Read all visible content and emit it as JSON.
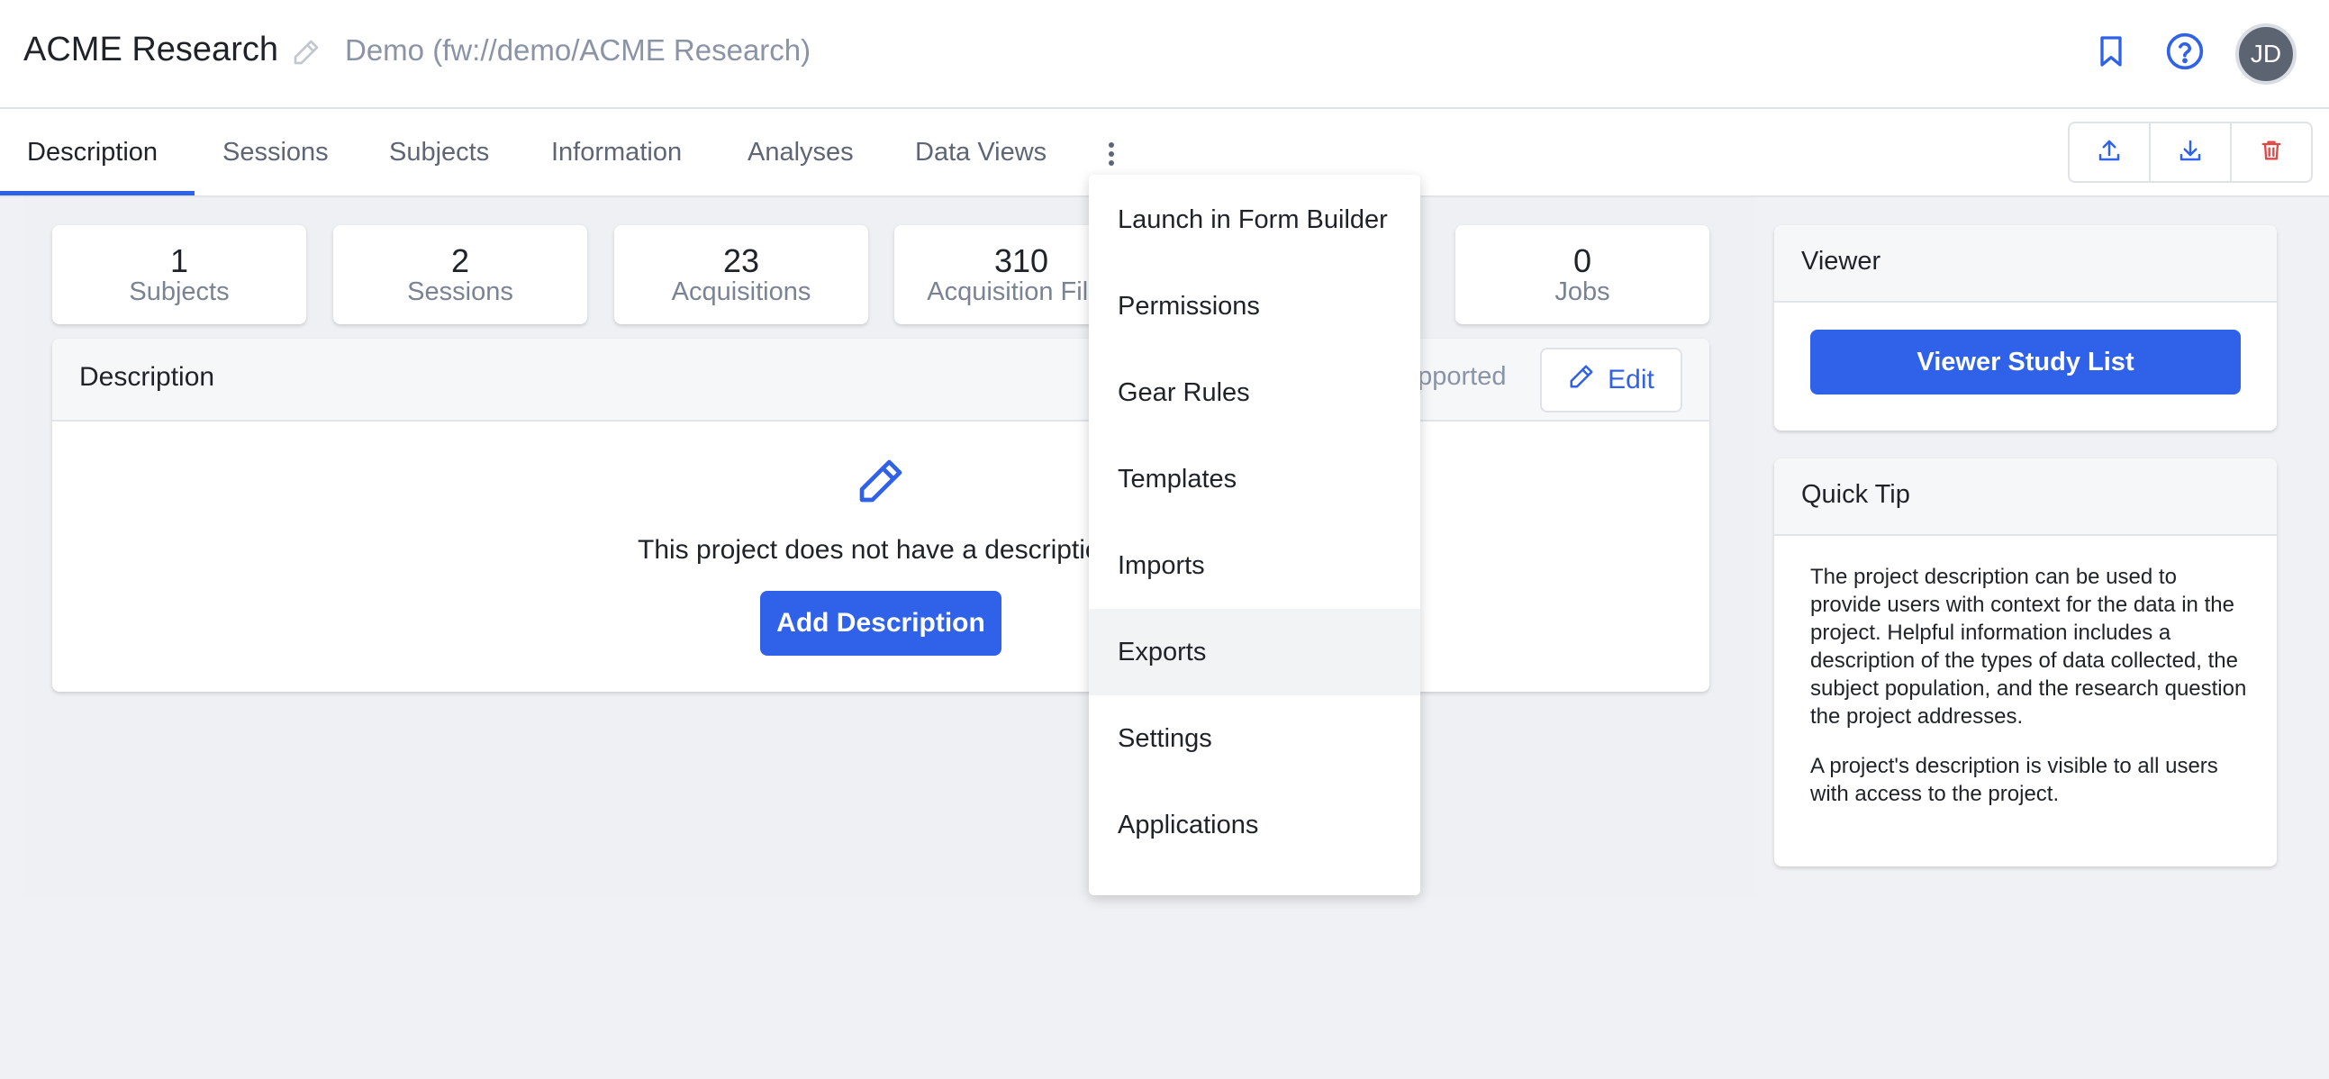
{
  "header": {
    "project_title": "ACME Research",
    "project_path": "Demo (fw://demo/ACME Research)",
    "avatar_initials": "JD"
  },
  "tabs": [
    {
      "label": "Description",
      "active": true
    },
    {
      "label": "Sessions"
    },
    {
      "label": "Subjects"
    },
    {
      "label": "Information"
    },
    {
      "label": "Analyses"
    },
    {
      "label": "Data Views"
    }
  ],
  "stats": [
    {
      "value": "1",
      "label": "Subjects"
    },
    {
      "value": "2",
      "label": "Sessions"
    },
    {
      "value": "23",
      "label": "Acquisitions"
    },
    {
      "value": "310",
      "label": "Acquisition Files"
    },
    {
      "value": "0",
      "label": "Jobs"
    }
  ],
  "description": {
    "title": "Description",
    "markdown_note": "upported",
    "edit_label": "Edit",
    "empty_text": "This project does not have a description",
    "add_label": "Add Description"
  },
  "viewer": {
    "title": "Viewer",
    "button_label": "Viewer Study List"
  },
  "quick_tip": {
    "title": "Quick Tip",
    "paragraph1": "The project description can be used to provide users with context for the data in the project. Helpful information includes a description of the types of data collected, the subject population, and the research question the project addresses.",
    "paragraph2": "A project's description is visible to all users with access to the project."
  },
  "menu": {
    "items": [
      {
        "label": "Launch in Form Builder"
      },
      {
        "label": "Permissions"
      },
      {
        "label": "Gear Rules"
      },
      {
        "label": "Templates"
      },
      {
        "label": "Imports"
      },
      {
        "label": "Exports",
        "hovered": true
      },
      {
        "label": "Settings"
      },
      {
        "label": "Applications"
      }
    ]
  },
  "colors": {
    "accent": "#2f62e9",
    "delete": "#e04848",
    "muted_text": "#8a94a6"
  }
}
